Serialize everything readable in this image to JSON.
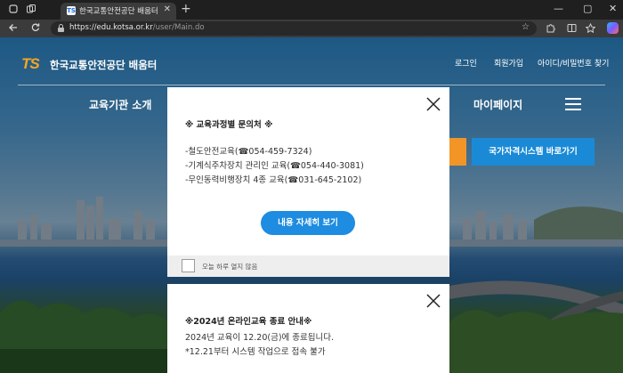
{
  "browser": {
    "tab_title": "한국교통안전공단 배움터",
    "tab_favicon": "TS",
    "url_host": "https://edu.kotsa.or.kr",
    "url_path": "/user/Main.do",
    "icons": [
      "tab-actions-icon",
      "workspaces-icon",
      "close-icon",
      "new-tab-icon",
      "minimize-icon",
      "maximize-icon",
      "close-window-icon",
      "back-icon",
      "refresh-icon",
      "lock-icon",
      "star-icon",
      "extensions-icon",
      "split-screen-icon",
      "favorites-icon",
      "copilot-icon"
    ]
  },
  "site": {
    "logo_mark": "TS",
    "logo_name": "한국교통안전공단 배움터",
    "top_links": [
      "로그인",
      "회원가입",
      "아이디/비밀번호 찾기"
    ],
    "gnb": [
      "교육기관 소개",
      "마이페이지"
    ],
    "btn_national": "국가자격시스템 바로가기",
    "colors": {
      "accent_blue": "#1b8ad6",
      "accent_orange": "#f29527"
    }
  },
  "popup1": {
    "title": "※ 교육과정별 문의처 ※",
    "lines": [
      "-철도안전교육(☎054-459-7324)",
      "-기계식주차장치 관리인 교육(☎054-440-3081)",
      "-무인동력비행장치 4종 교육(☎031-645-2102)"
    ],
    "detail_button": "내용 자세히 보기",
    "dont_show_today": "오늘 하루 열지 않음"
  },
  "popup2": {
    "title": "※2024년 온라인교육 종료 안내※",
    "lines": [
      "2024년 교육이 12.20(금)에 종료됩니다.",
      "*12.21부터 시스템 작업으로 접속 불가"
    ]
  }
}
